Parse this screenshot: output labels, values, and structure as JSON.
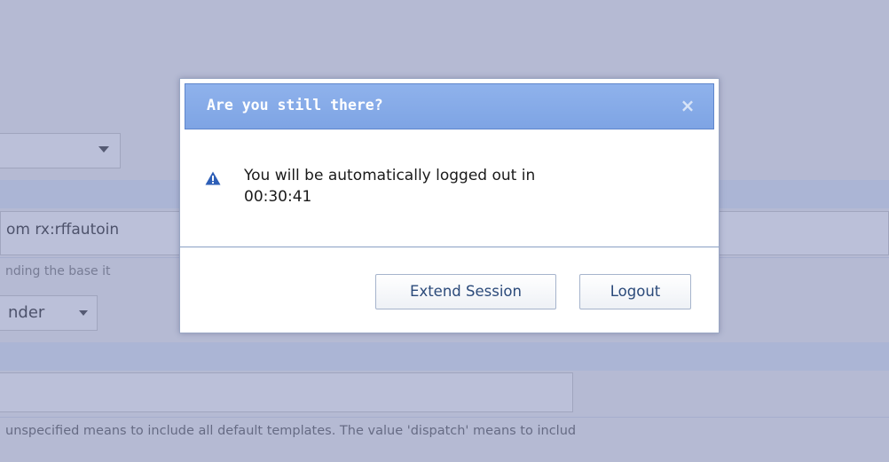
{
  "background": {
    "input_value": "om rx:rffautoin",
    "help_text_1": "nding the base it",
    "select_value": "nder",
    "help_text_2": "unspecified means to include all default templates. The value 'dispatch' means to includ"
  },
  "dialog": {
    "title": "Are you still there?",
    "close_glyph": "×",
    "icon": "warning-icon",
    "message_line1": "You will be automatically logged out in",
    "countdown": "00:30:41",
    "extend_button": "Extend Session",
    "logout_button": "Logout"
  },
  "colors": {
    "header_blue": "#7ea4e4",
    "overlay": "#8c96c8",
    "button_text": "#2b4a7a",
    "warning_icon": "#2e5fb7"
  }
}
